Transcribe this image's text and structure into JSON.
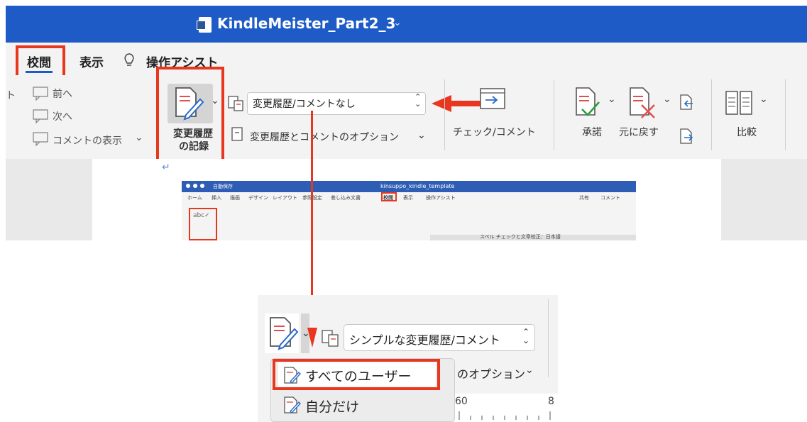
{
  "top": {
    "doc_title": "KindleMeister_Part2_3",
    "tabs": [
      "校閲",
      "表示",
      "操作アシスト"
    ],
    "nav": {
      "prev": "前へ",
      "next": "次へ",
      "show_comments": "コメントの表示",
      "partial_left": "ト"
    },
    "track_changes_label_1": "変更履歴",
    "track_changes_label_2": "の記録",
    "markup_select_value": "変更履歴/コメントなし",
    "markup_options_label": "変更履歴とコメントのオプション",
    "check_comment_label": "チェック/コメント",
    "accept_label": "承諾",
    "reject_label": "元に戻す",
    "compare_label": "比較",
    "mini": {
      "title": "kinsuppo_kindle_template",
      "autosave": "自動保存",
      "tabs": [
        "ホーム",
        "挿入",
        "描画",
        "デザイン",
        "レイアウト",
        "参照設定",
        "差し込み文書",
        "校閲",
        "表示",
        "操作アシスト"
      ],
      "share": "共有",
      "comment": "コメント",
      "status": "スペル チェックと文章校正：日本語"
    }
  },
  "bottom": {
    "markup_select_value": "シンプルな変更履歴/コメント",
    "options_partial": "のオプション",
    "menu_items": [
      "すべてのユーザー",
      "自分だけ"
    ],
    "ruler_numbers": [
      "60",
      "8"
    ]
  },
  "colors": {
    "accent": "#1e5bc6",
    "highlight": "#e8361f"
  }
}
